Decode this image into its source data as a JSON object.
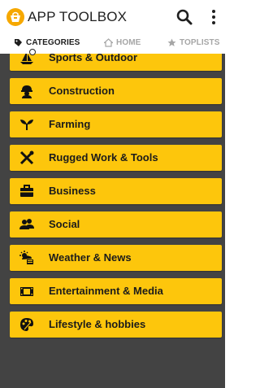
{
  "app": {
    "title": "APP TOOLBOX",
    "accent_color": "#fdc60c",
    "list_background": "#434343"
  },
  "toolbar": {
    "search_icon": "search-icon",
    "more_icon": "more-vert-icon"
  },
  "tabs": [
    {
      "label": "CATEGORIES",
      "icon": "tag-icon",
      "active": true
    },
    {
      "label": "HOME",
      "icon": "home-icon",
      "active": false
    },
    {
      "label": "TOPLISTS",
      "icon": "star-icon",
      "active": false
    }
  ],
  "categories": [
    {
      "label": "Sports & Outdoor",
      "icon": "sailboat-icon"
    },
    {
      "label": "Construction",
      "icon": "hard-hat-worker-icon"
    },
    {
      "label": "Farming",
      "icon": "sprout-icon"
    },
    {
      "label": "Rugged Work & Tools",
      "icon": "tools-icon"
    },
    {
      "label": "Business",
      "icon": "briefcase-icon"
    },
    {
      "label": "Social",
      "icon": "people-icon"
    },
    {
      "label": "Weather & News",
      "icon": "weather-news-icon"
    },
    {
      "label": "Entertainment & Media",
      "icon": "film-icon"
    },
    {
      "label": "Lifestyle & hobbies",
      "icon": "palette-icon"
    }
  ]
}
